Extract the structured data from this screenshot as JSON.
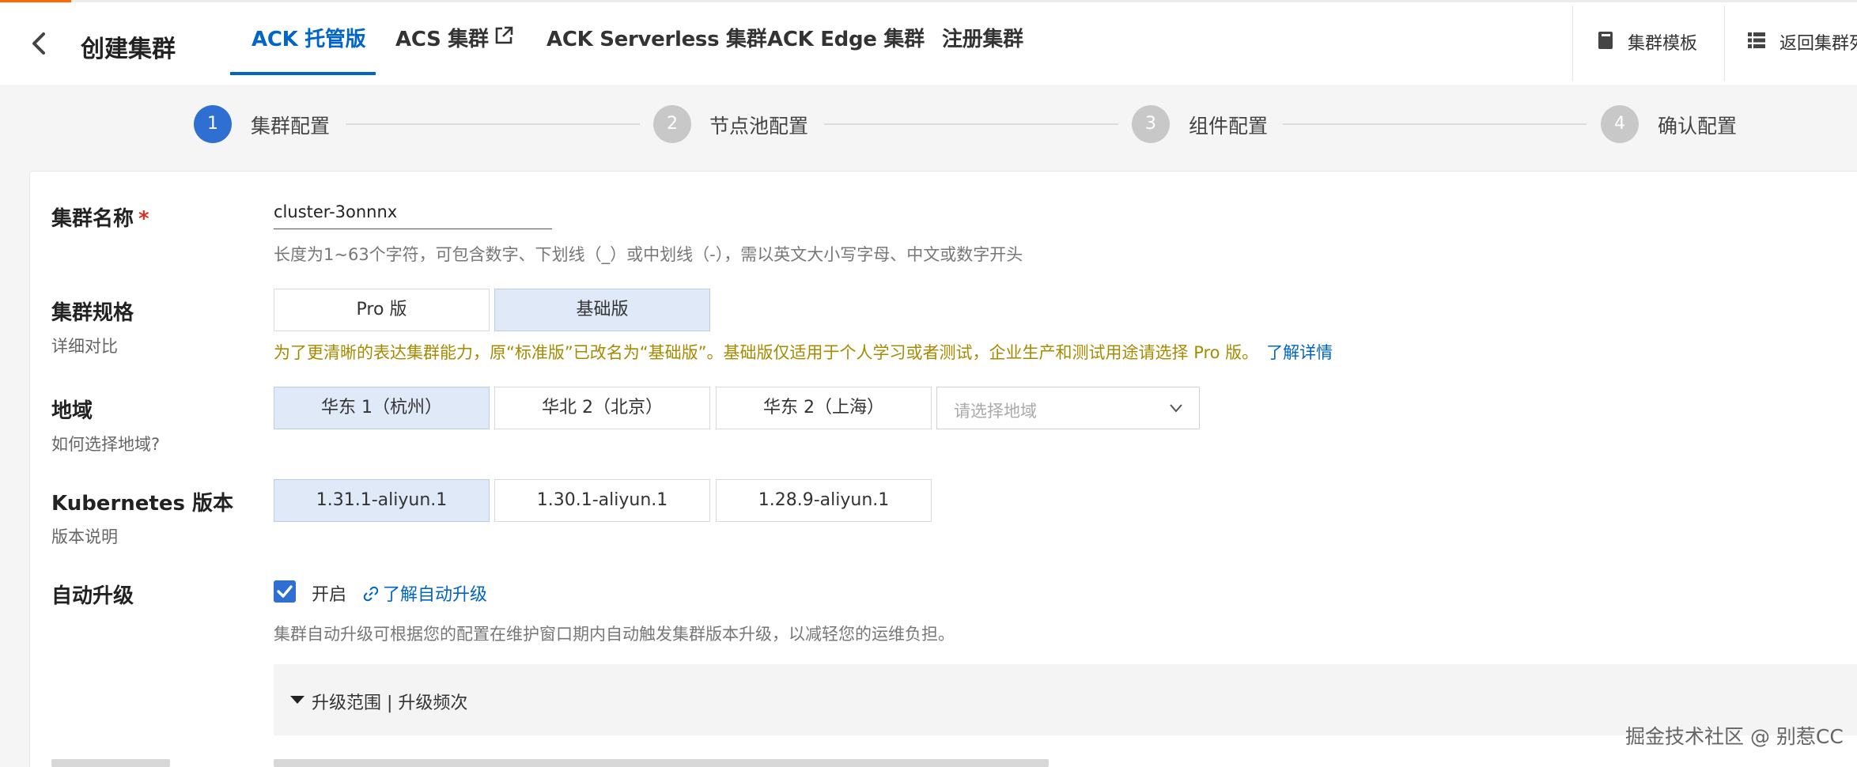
{
  "header": {
    "title": "创建集群",
    "tabs": [
      {
        "label": "ACK 托管版",
        "active": true
      },
      {
        "label": "ACS 集群",
        "external": true
      },
      {
        "label": "ACK Serverless 集群"
      },
      {
        "label": "ACK Edge 集群"
      },
      {
        "label": "注册集群"
      }
    ],
    "right_actions": {
      "template": "集群模板",
      "back_list": "返回集群列表"
    }
  },
  "steps": [
    {
      "num": "1",
      "label": "集群配置",
      "active": true
    },
    {
      "num": "2",
      "label": "节点池配置"
    },
    {
      "num": "3",
      "label": "组件配置"
    },
    {
      "num": "4",
      "label": "确认配置"
    }
  ],
  "form": {
    "cluster_name": {
      "label": "集群名称",
      "required_mark": "*",
      "value": "cluster-3onnnx",
      "hint": "长度为1~63个字符，可包含数字、下划线（_）或中划线（-），需以英文大小写字母、中文或数字开头"
    },
    "spec": {
      "label": "集群规格",
      "sublabel": "详细对比",
      "options": [
        "Pro 版",
        "基础版"
      ],
      "selected": "基础版",
      "notice": "为了更清晰的表达集群能力，原“标准版”已改名为“基础版”。基础版仅适用于个人学习或者测试，企业生产和测试用途请选择 Pro 版。",
      "notice_link": "了解详情"
    },
    "region": {
      "label": "地域",
      "sublabel": "如何选择地域?",
      "options": [
        "华东 1（杭州）",
        "华北 2（北京）",
        "华东 2（上海）"
      ],
      "selected": "华东 1（杭州）",
      "select_placeholder": "请选择地域"
    },
    "k8s_version": {
      "label": "Kubernetes 版本",
      "sublabel": "版本说明",
      "options": [
        "1.31.1-aliyun.1",
        "1.30.1-aliyun.1",
        "1.28.9-aliyun.1"
      ],
      "selected": "1.31.1-aliyun.1"
    },
    "auto_upgrade": {
      "label": "自动升级",
      "checked": true,
      "checkbox_label": "开启",
      "link": "了解自动升级",
      "hint": "集群自动升级可根据您的配置在维护窗口期内自动触发集群版本升级，以减轻您的运维负担。",
      "collapse_title": "升级范围 | 升级频次"
    }
  },
  "watermark": "掘金技术社区 @ 别惹CC",
  "colors": {
    "primary": "#0064c8",
    "step_active": "#2e6fd1",
    "selected_bg": "#dfe9f7",
    "notice": "#a68a00",
    "brand_accent": "#ff6a00"
  }
}
